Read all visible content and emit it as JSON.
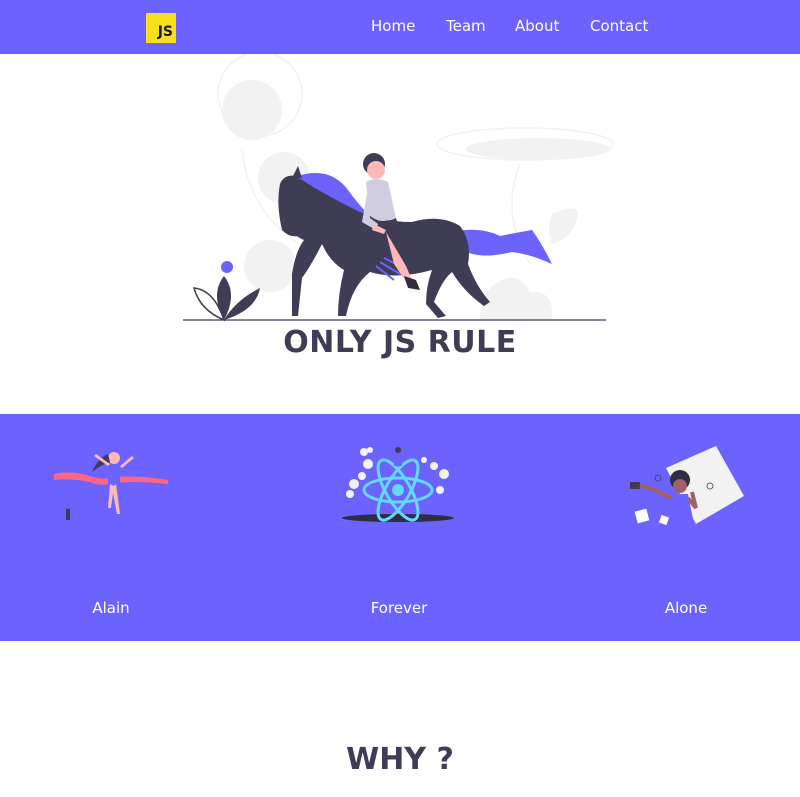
{
  "navbar": {
    "logo_text": "JS",
    "links": [
      {
        "label": "Home"
      },
      {
        "label": "Team"
      },
      {
        "label": "About"
      },
      {
        "label": "Contact"
      }
    ]
  },
  "hero": {
    "title": "ONLY JS RULE",
    "illustration": "woman-riding-horse-illustration"
  },
  "features": [
    {
      "label": "Alain",
      "illustration": "runner-finish-line-illustration"
    },
    {
      "label": "Forever",
      "illustration": "react-atom-illustration"
    },
    {
      "label": "Alone",
      "illustration": "woman-selfie-illustration"
    }
  ],
  "why": {
    "title": "WHY ?"
  },
  "colors": {
    "accent": "#6c63ff",
    "dark": "#3f3d56",
    "logo_bg": "#f7df1e",
    "light_gray": "#f2f2f2",
    "ribbon": "#ff6584",
    "react": "#61dafb"
  }
}
